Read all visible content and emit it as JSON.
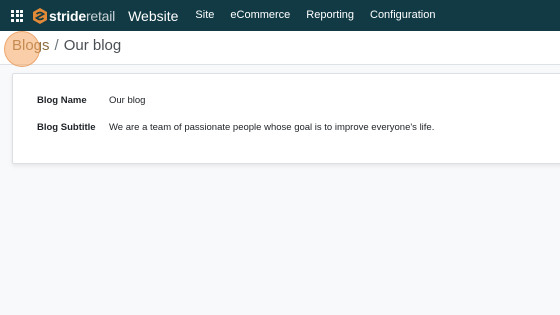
{
  "navbar": {
    "logo_bold": "stride",
    "logo_light": "retail",
    "app_name": "Website",
    "menu": [
      "Site",
      "eCommerce",
      "Reporting",
      "Configuration"
    ],
    "apps_icon": "grid-icon",
    "bg_color": "#113a45"
  },
  "breadcrumb": {
    "parent": "Blogs",
    "separator": "/",
    "current": "Our blog"
  },
  "form": {
    "fields": [
      {
        "label": "Blog Name",
        "value": "Our blog"
      },
      {
        "label": "Blog Subtitle",
        "value": "We are a team of passionate people whose goal is to improve everyone's life."
      }
    ]
  }
}
